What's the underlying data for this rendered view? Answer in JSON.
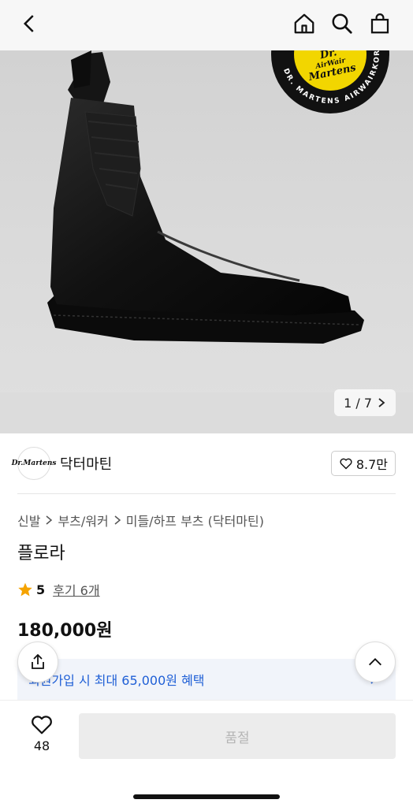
{
  "header": {
    "back_icon": "chevron-left-icon",
    "home_icon": "home-icon",
    "search_icon": "search-icon",
    "bag_icon": "shopping-bag-icon"
  },
  "hero": {
    "badge_logo_line1": "Dr.",
    "badge_logo_line2": "AirWair",
    "badge_logo_line3": "Martens",
    "badge_ring_text": "DR. MARTENS AIRWAIRKOREA",
    "counter": "1 / 7"
  },
  "brand": {
    "logo_text": "Dr.Martens",
    "name": "닥터마틴",
    "likes": "8.7만"
  },
  "breadcrumb": [
    "신발",
    "부츠/워커",
    "미들/하프 부츠 (닥터마틴)"
  ],
  "product": {
    "title": "플로라",
    "rating": "5",
    "reviews": "후기 6개",
    "price": "180,000원"
  },
  "promo": {
    "text": "회원가입 시 최대 65,000원 혜택"
  },
  "bottom": {
    "wish_count": "48",
    "soldout_label": "품절"
  },
  "colors": {
    "accent_blue": "#1f5fd6",
    "star": "#f5a300",
    "badge_yellow": "#f2d600"
  }
}
